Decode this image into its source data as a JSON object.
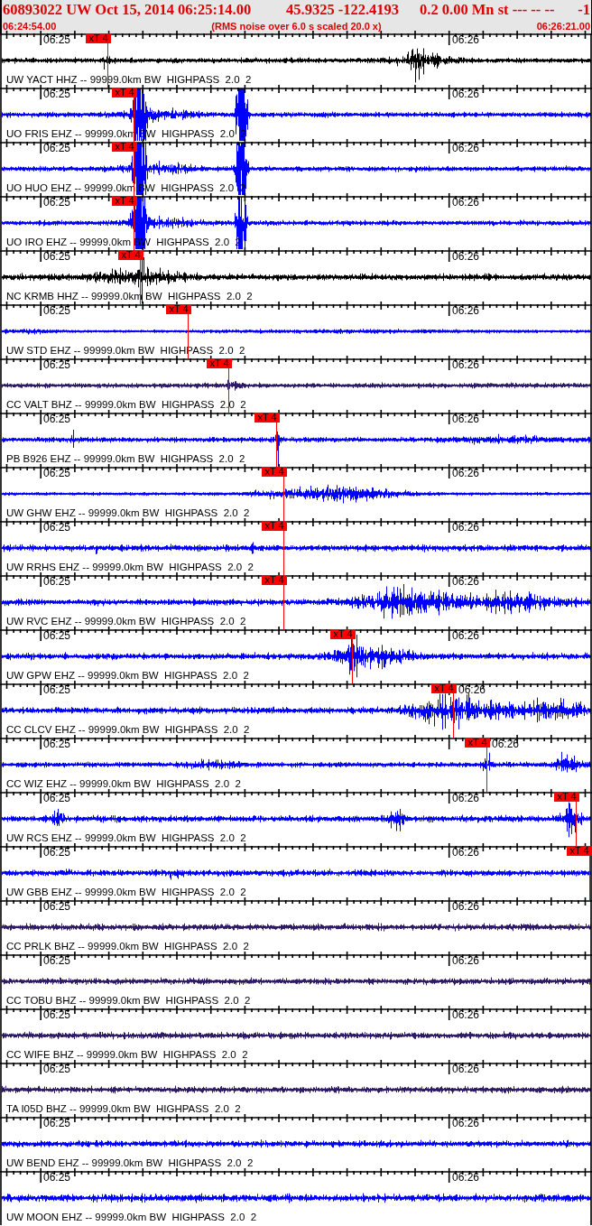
{
  "header": {
    "title_parts": [
      "60893022 UW Oct 15, 2014 06:25:14.00",
      "45.9325 -122.4193",
      "0.2 0.00 Mn st --- -- --",
      "-1"
    ],
    "start_time": "06:24:54.00",
    "note": "(RMS noise over 6.0 s scaled 20.0 x)",
    "end_time": "06:26:21.00"
  },
  "traces": [
    {
      "channel": "UW YACT HHZ -- 99999.0km BW  HIGHPASS  2.0  2",
      "color": "#000000",
      "time_labels": [
        "06:25",
        "06:26"
      ],
      "pick": "xT 4"
    },
    {
      "channel": "UO FRIS EHZ -- 99999.0km BW  HIGHPASS  2.0  2",
      "color": "#0000ff",
      "time_labels": [
        "06:25",
        "06:26"
      ],
      "pick": "xT 4"
    },
    {
      "channel": "UO HUO EHZ -- 99999.0km BW  HIGHPASS  2.0  2",
      "color": "#0000ff",
      "time_labels": [
        "06:25",
        "06:26"
      ],
      "pick": "xT 4"
    },
    {
      "channel": "UO IRO EHZ -- 99999.0km BW  HIGHPASS  2.0  2",
      "color": "#0000ff",
      "time_labels": [
        "06:25",
        "06:26"
      ],
      "pick": "xT 4"
    },
    {
      "channel": "NC KRMB HHZ -- 99999.0km BW  HIGHPASS  2.0  2",
      "color": "#000000",
      "time_labels": [
        "06:25",
        "06:26"
      ],
      "pick": "xT 4"
    },
    {
      "channel": "UW STD EHZ -- 99999.0km BW  HIGHPASS  2.0  2",
      "color": "#0000ff",
      "time_labels": [
        "06:25",
        "06:26"
      ],
      "pick": "xT 4"
    },
    {
      "channel": "CC VALT BHZ -- 99999.0km BW  HIGHPASS  2.0  2",
      "color": "#2e1a66",
      "time_labels": [
        "06:25",
        "06:26"
      ],
      "pick": "xT 4"
    },
    {
      "channel": "PB B926 EHZ -- 99999.0km BW  HIGHPASS  2.0  2",
      "color": "#0000ff",
      "time_labels": [
        "06:25",
        "06:26"
      ],
      "pick": "xT 4"
    },
    {
      "channel": "UW GHW EHZ -- 99999.0km BW  HIGHPASS  2.0  2",
      "color": "#0000ff",
      "time_labels": [
        "06:25",
        "06:26"
      ],
      "pick": "xT 4"
    },
    {
      "channel": "UW RRHS EHZ -- 99999.0km BW  HIGHPASS  2.0  2",
      "color": "#0000ff",
      "time_labels": [
        "06:25",
        "06:26"
      ],
      "pick": "xT 4"
    },
    {
      "channel": "UW RVC EHZ -- 99999.0km BW  HIGHPASS  2.0  2",
      "color": "#0000ff",
      "time_labels": [
        "06:25",
        "06:26"
      ],
      "pick": "xT 4"
    },
    {
      "channel": "UW GPW EHZ -- 99999.0km BW  HIGHPASS  2.0  2",
      "color": "#0000ff",
      "time_labels": [
        "06:25",
        "06:26"
      ],
      "pick": "xT 4"
    },
    {
      "channel": "CC CLCV EHZ -- 99999.0km BW  HIGHPASS  2.0  2",
      "color": "#0000ff",
      "time_labels": [
        "06:25",
        "06:26"
      ],
      "pick": "xT 4"
    },
    {
      "channel": "CC WIZ EHZ -- 99999.0km BW  HIGHPASS  2.0  2",
      "color": "#0000ff",
      "time_labels": [
        "06:25",
        "06:26"
      ],
      "pick": "xT 4"
    },
    {
      "channel": "UW RCS EHZ -- 99999.0km BW  HIGHPASS  2.0  2",
      "color": "#0000ff",
      "time_labels": [
        "06:25",
        "06:26"
      ],
      "pick": "xT 4"
    },
    {
      "channel": "UW GBB EHZ -- 99999.0km BW  HIGHPASS  2.0  2",
      "color": "#0000ff",
      "time_labels": [
        "06:25",
        "06:26"
      ],
      "pick": "xT 4"
    },
    {
      "channel": "CC PRLK BHZ -- 99999.0km BW  HIGHPASS  2.0  2",
      "color": "#2e1a66",
      "time_labels": [
        "06:25",
        "06:26"
      ]
    },
    {
      "channel": "CC TOBU BHZ -- 99999.0km BW  HIGHPASS  2.0  2",
      "color": "#2e1a66",
      "time_labels": [
        "06:25",
        "06:26"
      ]
    },
    {
      "channel": "CC WIFE BHZ -- 99999.0km BW  HIGHPASS  2.0  2",
      "color": "#2e1a66",
      "time_labels": [
        "06:25",
        "06:26"
      ]
    },
    {
      "channel": "TA I05D BHZ -- 99999.0km BW  HIGHPASS  2.0  2",
      "color": "#2e1a66",
      "time_labels": [
        "06:25",
        "06:26"
      ]
    },
    {
      "channel": "UW BEND EHZ -- 99999.0km BW  HIGHPASS  2.0  2",
      "color": "#0000ff",
      "time_labels": [
        "06:25",
        "06:26"
      ]
    },
    {
      "channel": "UW MOON EHZ -- 99999.0km BW  HIGHPASS  2.0  2",
      "color": "#0000ff",
      "time_labels": [
        "06:25",
        "06:26"
      ]
    }
  ]
}
